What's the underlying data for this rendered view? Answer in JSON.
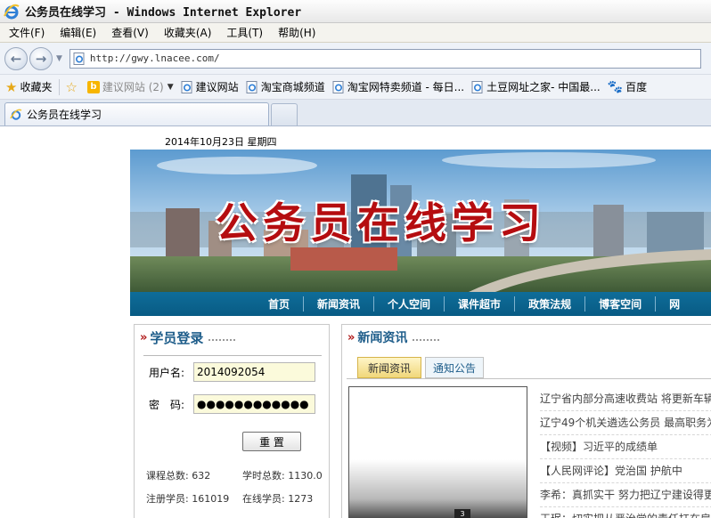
{
  "window": {
    "title": "公务员在线学习 - Windows Internet Explorer"
  },
  "menu": [
    "文件(F)",
    "编辑(E)",
    "查看(V)",
    "收藏夹(A)",
    "工具(T)",
    "帮助(H)"
  ],
  "address": {
    "url": "http://gwy.lnacee.com/"
  },
  "favorites": {
    "label": "收藏夹",
    "items": [
      {
        "label": "建议网站 (2)",
        "icon": "bing-icon"
      },
      {
        "label": "建议网站",
        "icon": "ie-page-icon"
      },
      {
        "label": "淘宝商城频道",
        "icon": "ie-page-icon"
      },
      {
        "label": "淘宝网特卖频道 - 每日...",
        "icon": "ie-page-icon"
      },
      {
        "label": "土豆网址之家- 中国最...",
        "icon": "ie-page-icon"
      },
      {
        "label": "百度",
        "icon": "baidu-icon"
      }
    ]
  },
  "tab": {
    "label": "公务员在线学习"
  },
  "page": {
    "date": "2014年10月23日 星期四",
    "banner_title": "公务员在线学习",
    "nav": [
      "首页",
      "新闻资讯",
      "个人空间",
      "课件超市",
      "政策法规",
      "博客空间",
      "网"
    ],
    "login": {
      "title": "学员登录",
      "username_label": "用户名:",
      "username_value": "2014092054",
      "password_label": "密　码:",
      "password_value": "●●●●●●●●●●●●",
      "reset_label": "重 置",
      "stats": {
        "courses": "课程总数: 632",
        "hours": "学时总数: 1130.0",
        "registered": "注册学员: 161019",
        "online": "在线学员: 1273"
      }
    },
    "news": {
      "title": "新闻资讯",
      "tabs": [
        "新闻资讯",
        "通知公告"
      ],
      "thumb_number": "3",
      "items": [
        "辽宁省内部分高速收费站 将更新车辆",
        "辽宁49个机关遴选公务员 最高职务为",
        "【视频】习近平的成绩单",
        "【人民网评论】党治国 护航中",
        "李希：真抓实干 努力把辽宁建设得更",
        "王珉：切实把从严治党的责任扛在肩"
      ]
    }
  },
  "colors": {
    "nav_bg": "#0a6390",
    "title_red": "#b50d10",
    "section_blue": "#1e5d8a"
  }
}
